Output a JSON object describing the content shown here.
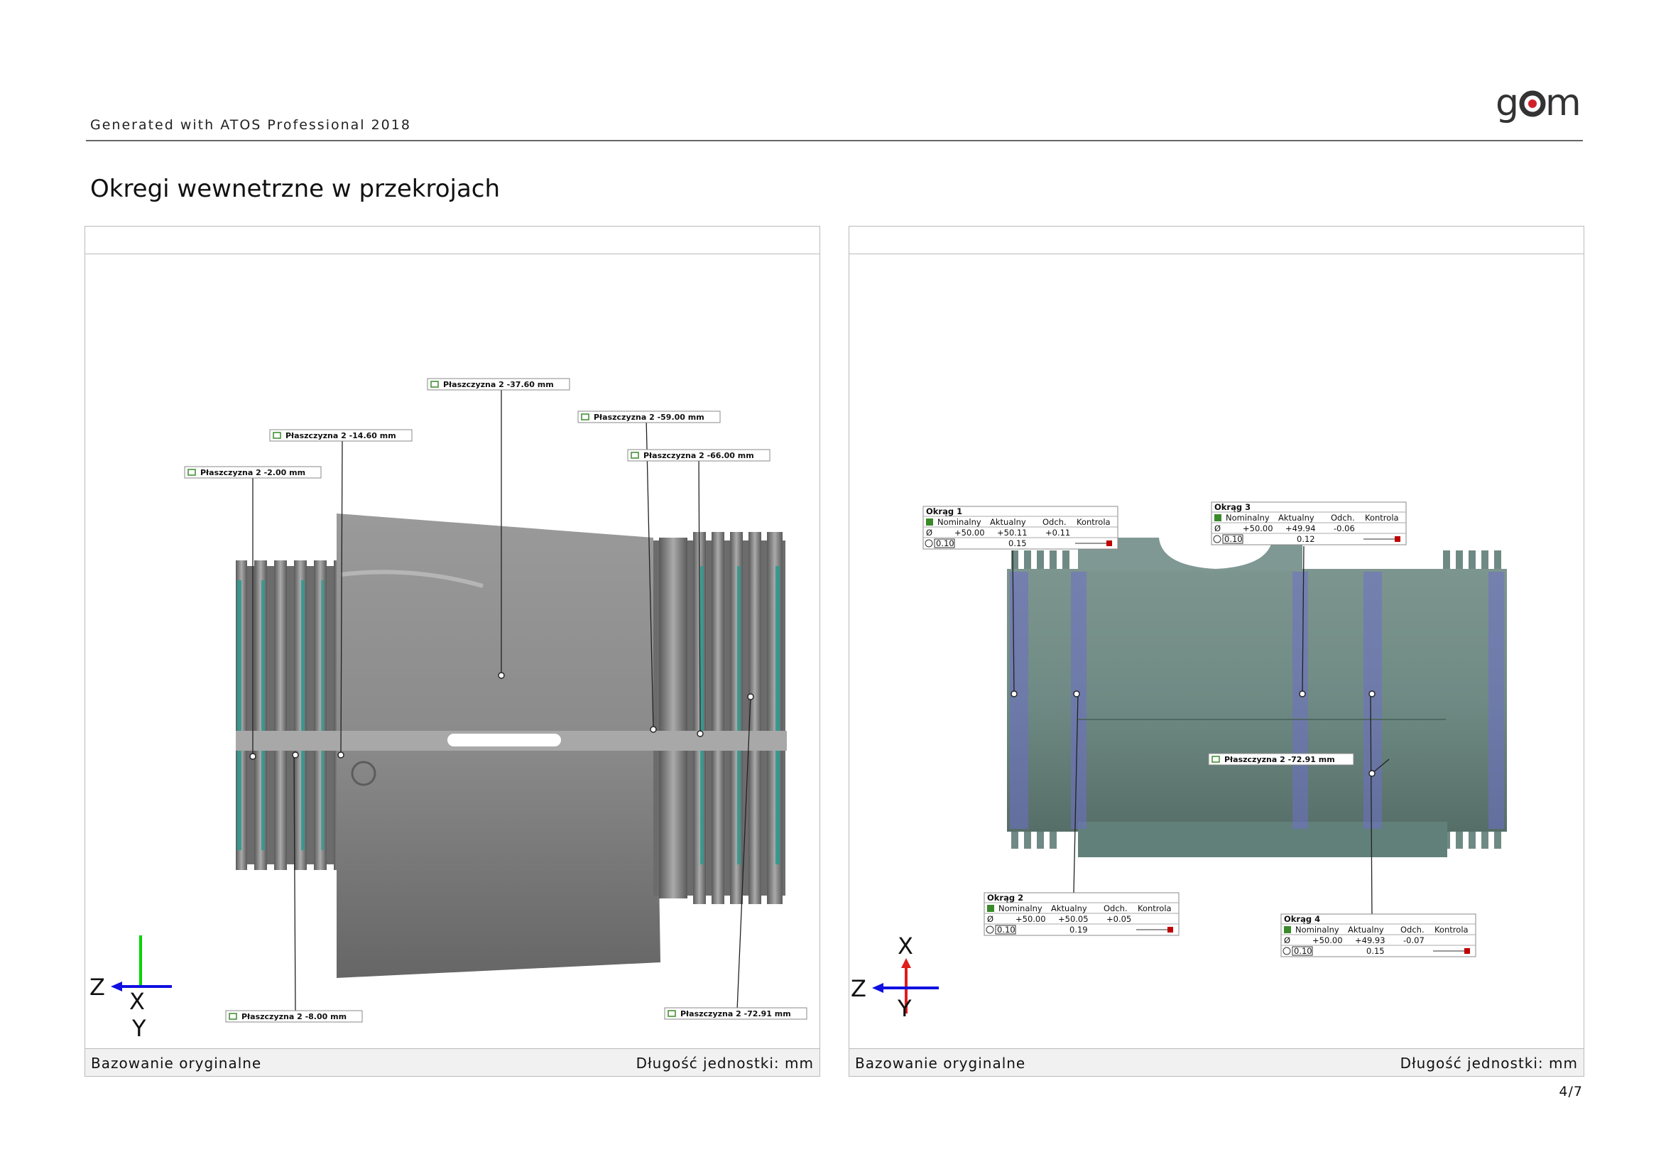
{
  "header": {
    "generated_text": "Generated with ATOS Professional 2018",
    "logo_text": "gom",
    "logo_accent": "#d0202a"
  },
  "page_title": "Okregi wewnetrzne w przekrojach",
  "colors": {
    "part_gray": "#7d7d7d",
    "part_teal": "#6f8a84",
    "highlight_teal": "#2a9a8e",
    "section_blue": "#6d6fc8",
    "axis_x": "#e01c1c",
    "axis_y": "#00d400",
    "axis_z": "#1010e0"
  },
  "left_panel": {
    "footer_left": "Bazowanie oryginalne",
    "footer_right": "Długość jednostki: mm",
    "plane_labels": [
      "Płaszczyzna 2 -37.60 mm",
      "Płaszczyzna 2 -59.00 mm",
      "Płaszczyzna 2 -14.60 mm",
      "Płaszczyzna 2 -66.00 mm",
      "Płaszczyzna 2 -2.00 mm",
      "Płaszczyzna 2 -8.00 mm",
      "Płaszczyzna 2 -72.91 mm"
    ],
    "axes": {
      "horizontal": "Z",
      "out_of_plane": "X",
      "vertical": "Y"
    }
  },
  "right_panel": {
    "footer_left": "Bazowanie oryginalne",
    "footer_right": "Długość jednostki: mm",
    "plane_label": "Płaszczyzna 2 -72.91 mm",
    "table_headers": [
      "Nominalny",
      "Aktualny",
      "Odch.",
      "Kontrola"
    ],
    "diameter_symbol": "Ø",
    "tolerance_value": "0.10",
    "tables": [
      {
        "title": "Okrąg 1",
        "nominal": "+50.00",
        "actual": "+50.11",
        "deviation": "+0.11",
        "form": "0.15"
      },
      {
        "title": "Okrąg 3",
        "nominal": "+50.00",
        "actual": "+49.94",
        "deviation": "-0.06",
        "form": "0.12"
      },
      {
        "title": "Okrąg 2",
        "nominal": "+50.00",
        "actual": "+50.05",
        "deviation": "+0.05",
        "form": "0.19"
      },
      {
        "title": "Okrąg 4",
        "nominal": "+50.00",
        "actual": "+49.93",
        "deviation": "-0.07",
        "form": "0.15"
      }
    ],
    "axes": {
      "vertical": "X",
      "horizontal": "Z",
      "out_of_plane": "Y"
    }
  },
  "pager": "4/7"
}
